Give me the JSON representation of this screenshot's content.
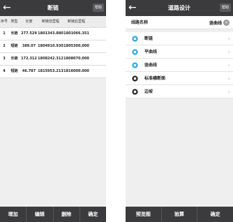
{
  "left": {
    "back_icon": "←",
    "title": "断链",
    "help_label": "帮助",
    "columns": [
      "序号",
      "类型",
      "长度",
      "断链前里程",
      "断链后里程"
    ],
    "rows": [
      [
        "1",
        "长链",
        "277.529",
        "1801343.880",
        "1801066.351"
      ],
      [
        "2",
        "短链",
        "389.07",
        "1804910.930",
        "1805300.000"
      ],
      [
        "3",
        "长链",
        "172.312",
        "1808242.312",
        "1808070.000"
      ],
      [
        "4",
        "短链",
        "46.787",
        "1815953.213",
        "1816000.000"
      ]
    ],
    "buttons": [
      "增加",
      "编辑",
      "删除",
      "确定"
    ]
  },
  "right": {
    "back_icon": "←",
    "title": "道路设计",
    "help_label": "帮助",
    "route_name_label": "线路名称",
    "route_name_value": "竖曲线",
    "clear_icon": "×",
    "menu": [
      {
        "label": "断链",
        "icon": "gear-icon",
        "color": "#29a7e1"
      },
      {
        "label": "平曲线",
        "icon": "gear-icon",
        "color": "#29a7e1"
      },
      {
        "label": "竖曲线",
        "icon": "gear-icon",
        "color": "#29a7e1"
      },
      {
        "label": "标准横断面",
        "icon": "gear-icon",
        "color": "#222222"
      },
      {
        "label": "边坡",
        "icon": "gear-icon",
        "color": "#222222"
      }
    ],
    "chevron": "›",
    "buttons": [
      "预览图",
      "验算",
      "确定"
    ]
  }
}
